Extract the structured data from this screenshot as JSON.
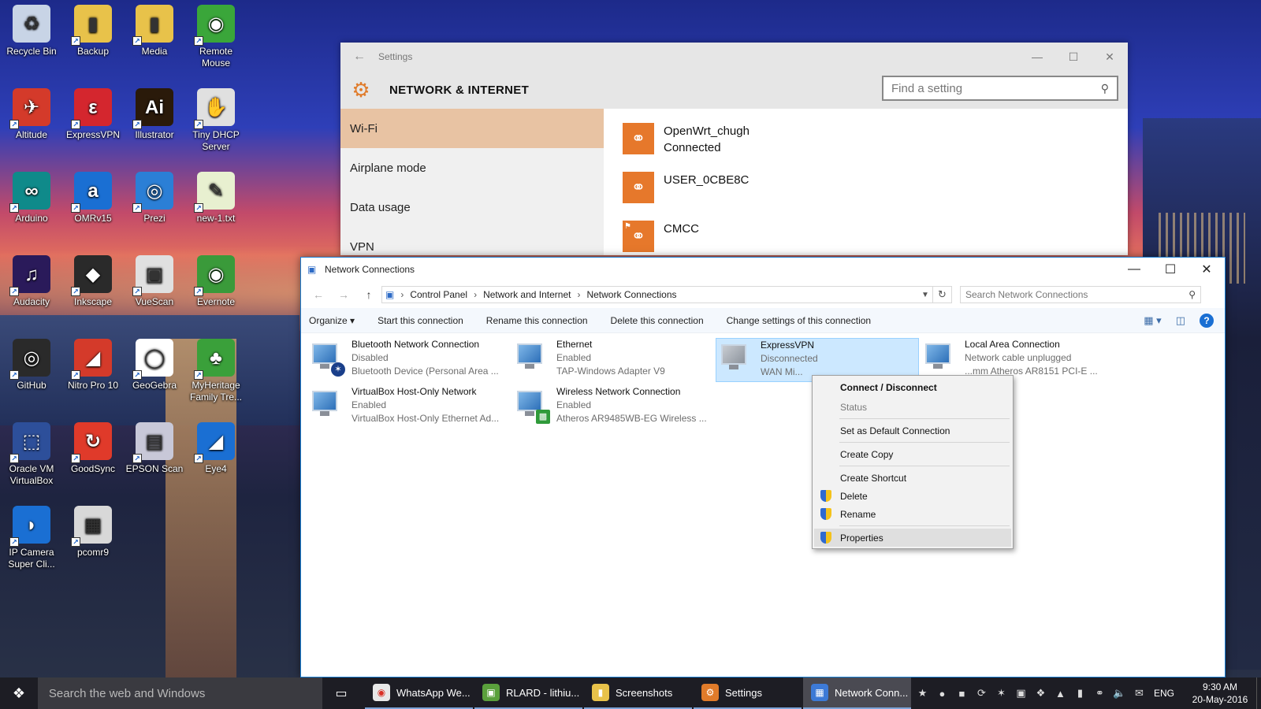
{
  "desktop": {
    "icons": [
      {
        "label": "Recycle Bin",
        "name": "recycle-bin-icon"
      },
      {
        "label": "Backup",
        "name": "folder-icon"
      },
      {
        "label": "Media",
        "name": "folder-icon"
      },
      {
        "label": "Remote Mouse",
        "name": "remote-mouse-icon"
      },
      {
        "label": "Altitude",
        "name": "plane-icon"
      },
      {
        "label": "ExpressVPN",
        "name": "expressvpn-icon"
      },
      {
        "label": "Illustrator",
        "name": "illustrator-icon"
      },
      {
        "label": "Tiny DHCP Server",
        "name": "handshake-icon"
      },
      {
        "label": "Arduino",
        "name": "arduino-icon"
      },
      {
        "label": "OMRv15",
        "name": "omr-icon"
      },
      {
        "label": "Prezi",
        "name": "prezi-icon"
      },
      {
        "label": "new-1.txt",
        "name": "text-file-icon"
      },
      {
        "label": "Audacity",
        "name": "audacity-icon"
      },
      {
        "label": "Inkscape",
        "name": "inkscape-icon"
      },
      {
        "label": "VueScan",
        "name": "vuescan-icon"
      },
      {
        "label": "Evernote",
        "name": "evernote-icon"
      },
      {
        "label": "GitHub",
        "name": "github-icon"
      },
      {
        "label": "Nitro Pro 10",
        "name": "nitro-icon"
      },
      {
        "label": "GeoGebra",
        "name": "geogebra-icon"
      },
      {
        "label": "MyHeritage Family Tre...",
        "name": "myheritage-icon"
      },
      {
        "label": "Oracle VM VirtualBox",
        "name": "virtualbox-icon"
      },
      {
        "label": "GoodSync",
        "name": "goodsync-icon"
      },
      {
        "label": "EPSON Scan",
        "name": "scanner-icon"
      },
      {
        "label": "Eye4",
        "name": "eye4-icon"
      },
      {
        "label": "IP Camera Super Cli...",
        "name": "ip-camera-icon"
      },
      {
        "label": "pcomr9",
        "name": "pcomr-icon"
      }
    ]
  },
  "settings": {
    "window_title": "Settings",
    "header": "NETWORK & INTERNET",
    "search_placeholder": "Find a setting",
    "nav": [
      "Wi-Fi",
      "Airplane mode",
      "Data usage",
      "VPN"
    ],
    "wifi": [
      {
        "ssid": "OpenWrt_chugh",
        "status": "Connected"
      },
      {
        "ssid": "USER_0CBE8C",
        "status": ""
      },
      {
        "ssid": "CMCC",
        "status": ""
      }
    ]
  },
  "network": {
    "window_title": "Network Connections",
    "breadcrumb": [
      "Control Panel",
      "Network and Internet",
      "Network Connections"
    ],
    "search_placeholder": "Search Network Connections",
    "commands": [
      "Organize ▾",
      "Start this connection",
      "Rename this connection",
      "Delete this connection",
      "Change settings of this connection"
    ],
    "connections": [
      {
        "name": "Bluetooth Network Connection",
        "status": "Disabled",
        "device": "Bluetooth Device (Personal Area ..."
      },
      {
        "name": "Ethernet",
        "status": "Enabled",
        "device": "TAP-Windows Adapter V9"
      },
      {
        "name": "ExpressVPN",
        "status": "Disconnected",
        "device": "WAN Mi..."
      },
      {
        "name": "Local Area Connection",
        "status": "Network cable unplugged",
        "device": "...mm Atheros AR8151 PCI-E ..."
      },
      {
        "name": "VirtualBox Host-Only Network",
        "status": "Enabled",
        "device": "VirtualBox Host-Only Ethernet Ad..."
      },
      {
        "name": "Wireless Network Connection",
        "status": "Enabled",
        "device": "Atheros AR9485WB-EG Wireless ..."
      }
    ]
  },
  "context_menu": {
    "items": [
      "Connect / Disconnect",
      "Status",
      "Set as Default Connection",
      "Create Copy",
      "Create Shortcut",
      "Delete",
      "Rename",
      "Properties"
    ]
  },
  "taskbar": {
    "search_placeholder": "Search the web and Windows",
    "items": [
      {
        "label": "WhatsApp We...",
        "color": "#e8e8e8"
      },
      {
        "label": "RLARD - lithiu...",
        "color": "#5aa03c"
      },
      {
        "label": "Screenshots",
        "color": "#e8c24a"
      },
      {
        "label": "Settings",
        "color": "#e07b2a"
      },
      {
        "label": "Network Conn...",
        "color": "#3d7ad6"
      }
    ],
    "language": "ENG",
    "time": "9:30 AM",
    "date": "20-May-2016"
  }
}
